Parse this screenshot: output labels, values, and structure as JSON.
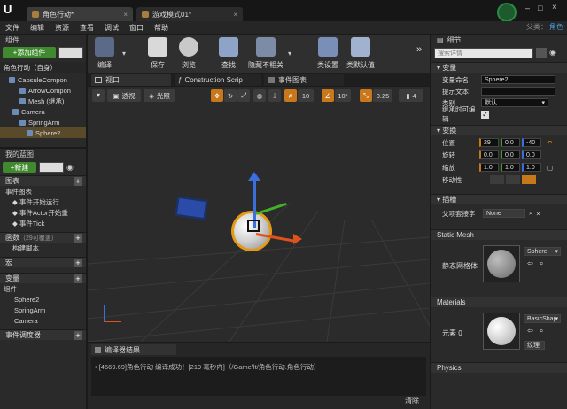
{
  "window": {
    "logo": "U",
    "tabs": [
      {
        "label": "角色行动*"
      },
      {
        "label": "游戏模式01*"
      }
    ],
    "parent_label": "父类：",
    "parent_value": "角色"
  },
  "menu": [
    "文件",
    "编辑",
    "资源",
    "查看",
    "调试",
    "窗口",
    "帮助"
  ],
  "components": {
    "title": "组件",
    "add_button": "+添加组件",
    "root": "角色行动（自身）",
    "tree": [
      {
        "label": "CapsuleCompon",
        "indent": 10
      },
      {
        "label": "ArrowCompon",
        "indent": 22
      },
      {
        "label": "Mesh (继承)",
        "indent": 22
      },
      {
        "label": "Camera",
        "indent": 14
      },
      {
        "label": "SpringArm",
        "indent": 22
      },
      {
        "label": "Sphere2",
        "indent": 30
      }
    ]
  },
  "toolbar": [
    {
      "label": "编译",
      "icon": "compile-icon"
    },
    {
      "label": "保存",
      "icon": "save-icon"
    },
    {
      "label": "浏览",
      "icon": "browse-icon"
    },
    {
      "label": "查找",
      "icon": "find-icon"
    },
    {
      "label": "隐藏不相关",
      "icon": "hide-unrelated-icon"
    },
    {
      "label": "类设置",
      "icon": "class-settings-icon"
    },
    {
      "label": "类默认值",
      "icon": "class-defaults-icon"
    }
  ],
  "mybp": {
    "title": "我的蓝图",
    "new_button": "+新建",
    "graphs_label": "图表",
    "event_graph": "事件图表",
    "events": [
      "事件开始运行",
      "事件Actor开始重",
      "事件Tick"
    ],
    "functions_label": "函数",
    "functions_count": "（29可覆盖）",
    "construct": "构建脚本",
    "macros": "宏",
    "variables": "变量",
    "components_label": "组件",
    "component_items": [
      "Sphere2",
      "SpringArm",
      "Camera"
    ],
    "dispatchers": "事件调度器"
  },
  "editor_tabs": [
    {
      "label": "视口"
    },
    {
      "label": "Construction Scrip"
    },
    {
      "label": "事件图表"
    }
  ],
  "viewport_bar": {
    "perspective": "透视",
    "lit": "光照",
    "grid": "10",
    "angle": "10°",
    "scale": "0.25",
    "speed": "4"
  },
  "compiler": {
    "title": "编译器结果",
    "message": "[4569.69]角色行动 编译成功！[219 毫秒内]（/Game/lt/角色行动.角色行动）",
    "clear": "清除"
  },
  "details": {
    "title": "细节",
    "search_placeholder": "搜索详情",
    "variable_section": "变量",
    "var_name_label": "变量命名",
    "var_name_value": "Sphere2",
    "tooltip_label": "提示文本",
    "category_label": "类别",
    "category_value": "默认",
    "editable_label": "继承时可编辑",
    "transform_section": "变换",
    "location_label": "位置",
    "location": [
      "29",
      "0.0",
      "-40"
    ],
    "rotation_label": "旋转",
    "rotation": [
      "0.0",
      "0.0",
      "0.0"
    ],
    "scale_label": "缩放",
    "scale": [
      "1.0",
      "1.0",
      "1.0"
    ],
    "mobility_label": "移动性",
    "socket_section": "插槽",
    "parent_socket_label": "父项套接字",
    "parent_socket_value": "None",
    "static_mesh_section": "Static Mesh",
    "static_mesh_label": "静态网格体",
    "static_mesh_value": "Sphere",
    "materials_section": "Materials",
    "element_label": "元素 0",
    "material_value": "BasicShap",
    "texture_label": "纹理",
    "physics_section": "Physics"
  }
}
